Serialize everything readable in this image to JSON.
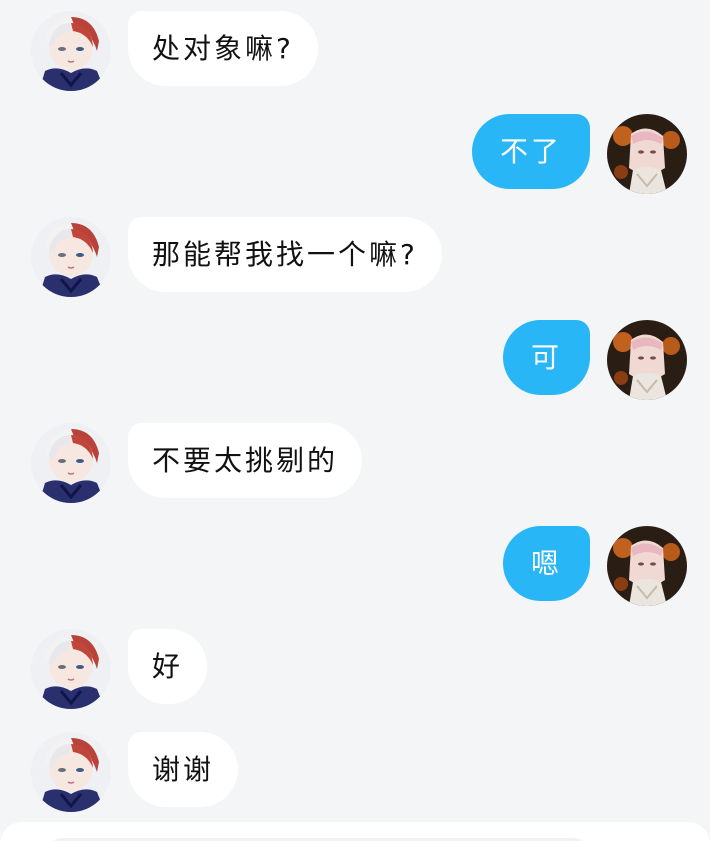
{
  "messages": [
    {
      "sender": "other",
      "text": "处对象嘛?"
    },
    {
      "sender": "self",
      "text": "不了"
    },
    {
      "sender": "other",
      "text": "那能帮我找一个嘛?"
    },
    {
      "sender": "self",
      "text": "可"
    },
    {
      "sender": "other",
      "text": "不要太挑剔的"
    },
    {
      "sender": "self",
      "text": "嗯"
    },
    {
      "sender": "other",
      "text": "好"
    },
    {
      "sender": "other",
      "text": "谢谢"
    }
  ],
  "colors": {
    "background": "#f4f5f7",
    "self_bubble": "#29b6f6",
    "other_bubble": "#ffffff"
  }
}
